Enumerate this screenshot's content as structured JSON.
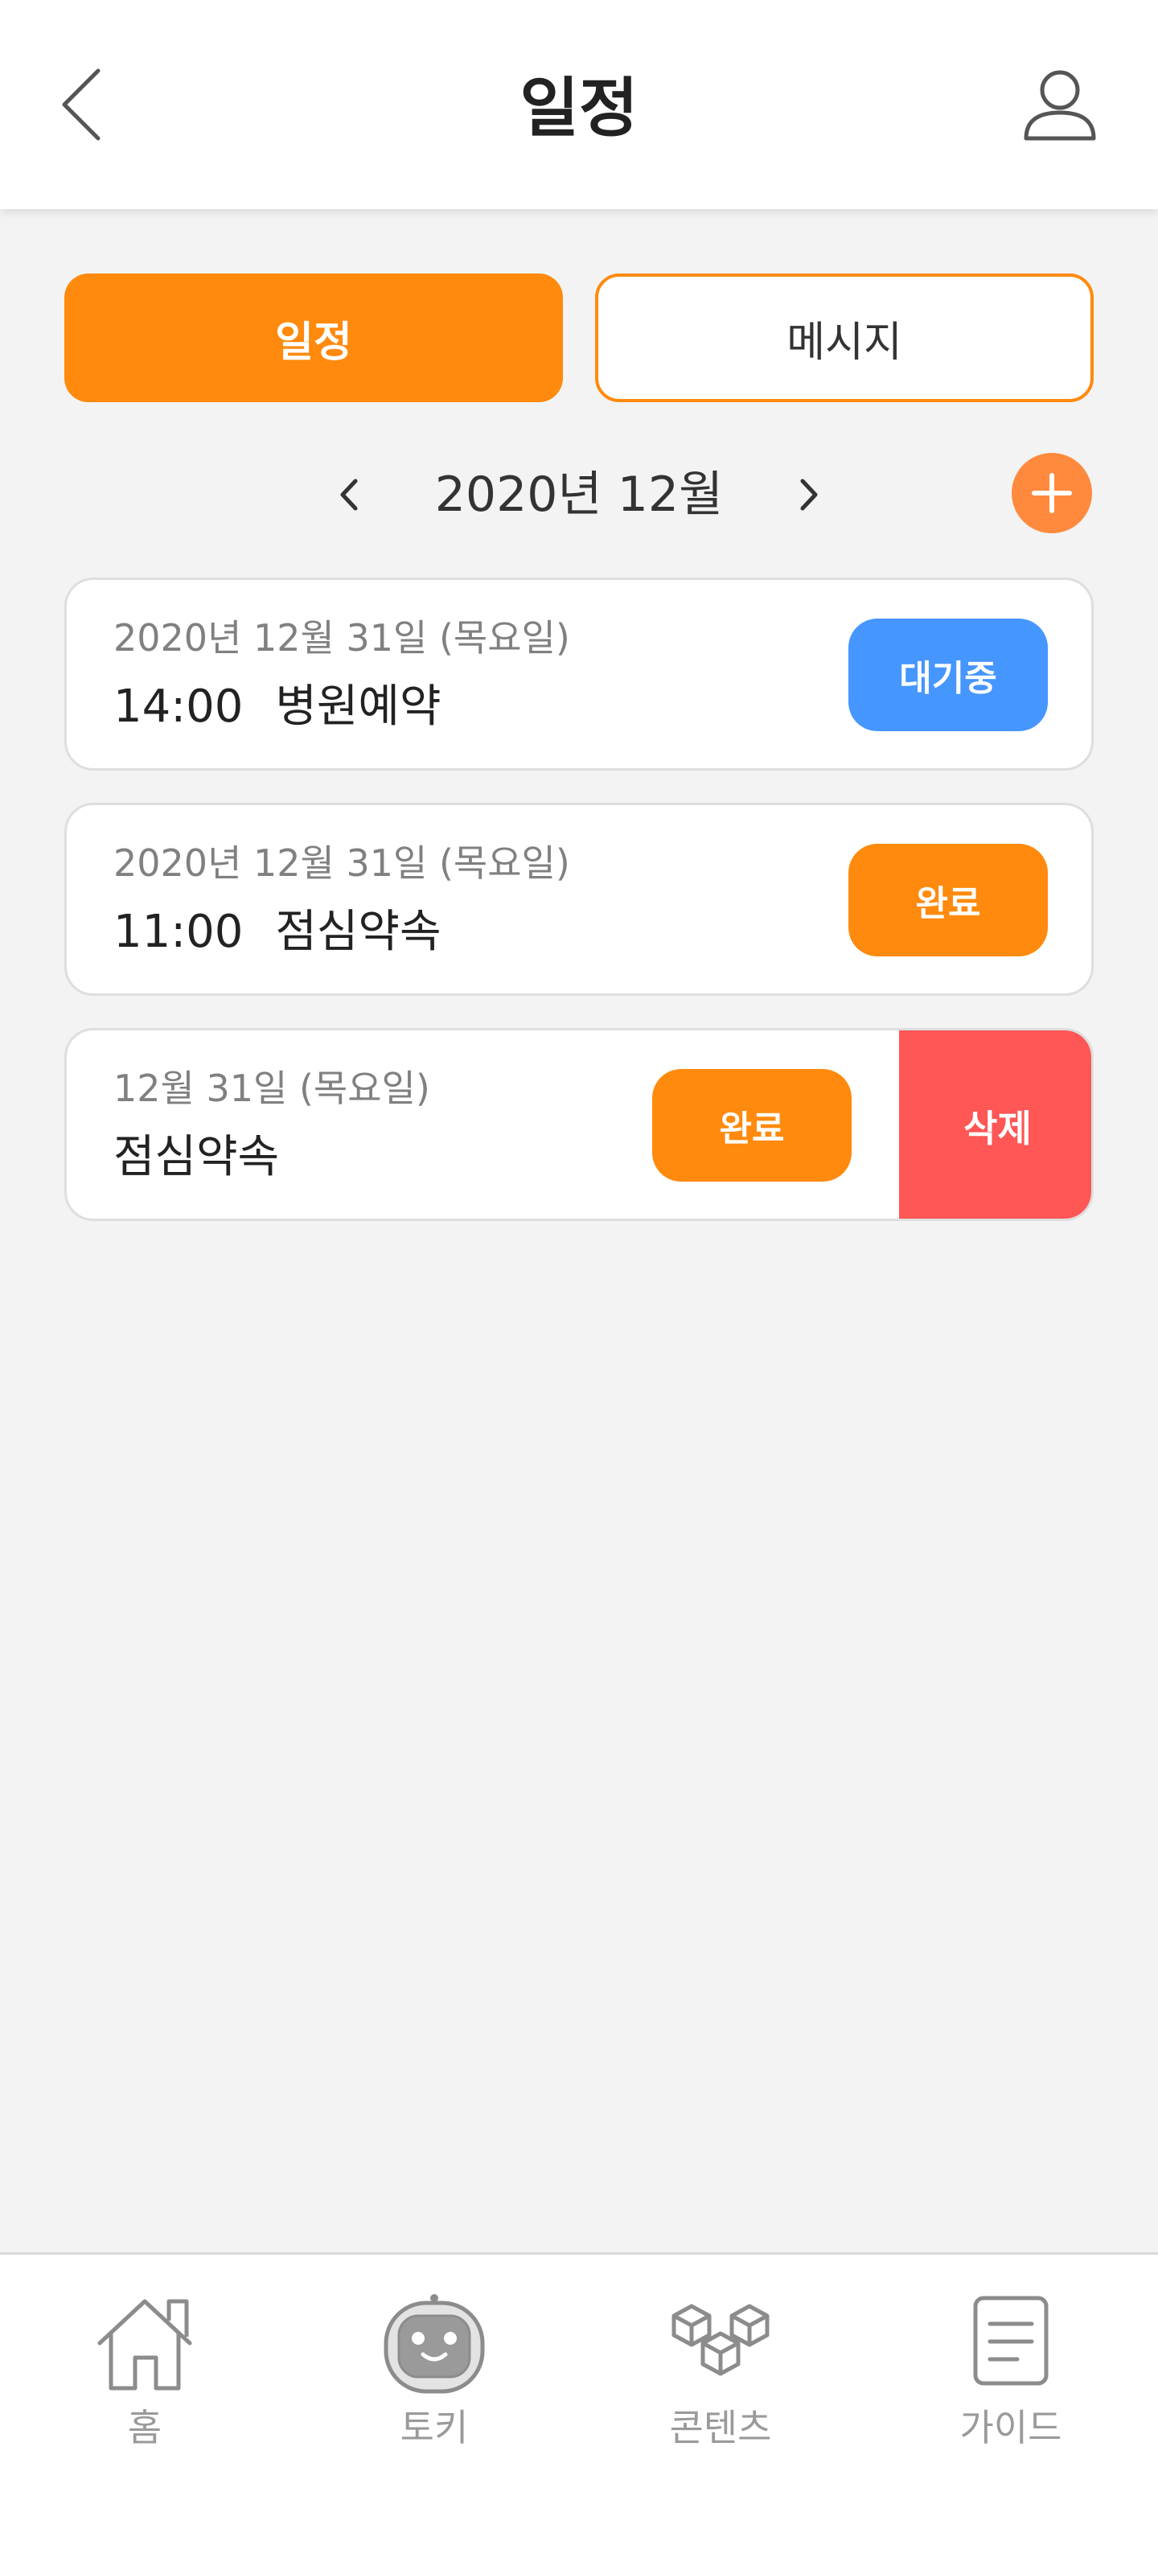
{
  "header": {
    "title": "일정",
    "back_icon": "chevron-left-icon",
    "profile_icon": "user-icon"
  },
  "tabs": [
    {
      "label": "일정",
      "active": true
    },
    {
      "label": "메시지",
      "active": false
    }
  ],
  "month_nav": {
    "label": "2020년 12월",
    "prev_icon": "chevron-left-icon",
    "next_icon": "chevron-right-icon",
    "add_icon": "plus-icon"
  },
  "schedules": [
    {
      "date": "2020년 12월 31일 (목요일)",
      "time": "14:00",
      "title": "병원예약",
      "status": "대기중",
      "status_color": "#4696ff"
    },
    {
      "date": "2020년 12월 31일 (목요일)",
      "time": "11:00",
      "title": "점심약속",
      "status": "완료",
      "status_color": "#ff8a0d"
    },
    {
      "date": "12월 31일 (목요일)",
      "time": "",
      "title": "점심약속",
      "status": "완료",
      "status_color": "#ff8a0d",
      "delete_label": "삭제"
    }
  ],
  "bottom_nav": [
    {
      "label": "홈",
      "icon": "home-icon"
    },
    {
      "label": "토키",
      "icon": "robot-icon"
    },
    {
      "label": "콘텐츠",
      "icon": "cubes-icon"
    },
    {
      "label": "가이드",
      "icon": "document-icon"
    }
  ],
  "colors": {
    "accent": "#ff8a0d",
    "waiting": "#4696ff",
    "delete": "#ff5656",
    "background": "#f3f3f3"
  }
}
